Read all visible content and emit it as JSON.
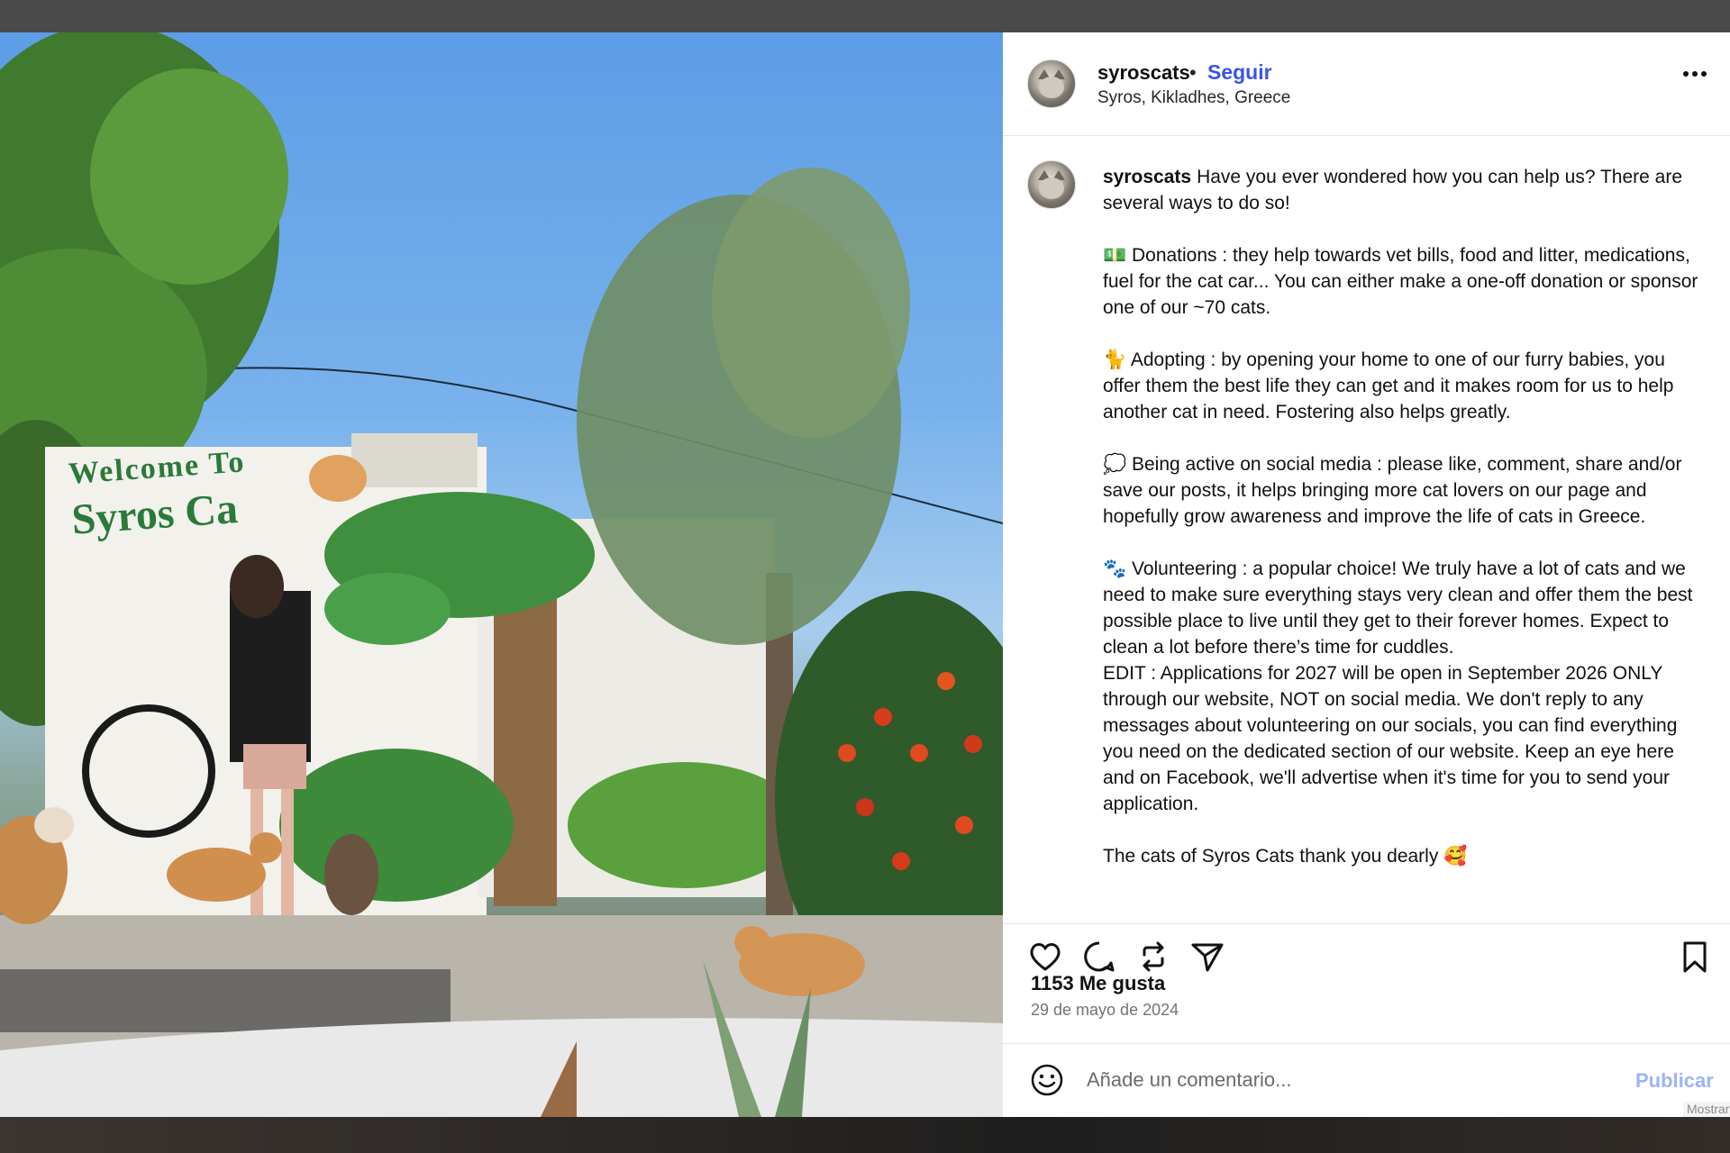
{
  "post": {
    "username": "syroscats",
    "separator": "•",
    "follow_label": "Seguir",
    "location": "Syros, Kikladhes, Greece",
    "more_icon": "more-horizontal-icon"
  },
  "photo": {
    "sign_line1": "Welcome To",
    "sign_line2": "Syros Ca"
  },
  "caption": {
    "username": "syroscats",
    "intro": "Have you ever wondered how you can help us? There are several ways to do so!",
    "donations": "💵 Donations : they help towards vet bills, food and litter, medications, fuel for the cat car... You can either make a one-off donation or sponsor one of our ~70 cats.",
    "adopting": "🐈 Adopting : by opening your home to one of our furry babies, you offer them the best life they can get and it makes room for us to help another cat in need. Fostering also helps greatly.",
    "social": "💭 Being active on social media : please like, comment, share and/or save our posts, it helps bringing more cat lovers on our page and hopefully grow awareness and improve the life of cats in Greece.",
    "volunteering": "🐾 Volunteering : a popular choice! We truly have a lot of cats and we need to make sure everything stays very clean and offer them the best possible place to live until they get to their forever homes. Expect to clean a lot before there’s time for cuddles.",
    "edit": "EDIT : Applications for 2027 will be open in September 2026 ONLY through our website, NOT on social media. We don't reply to any messages about volunteering on our socials, you can find everything you need on the dedicated section of our website. Keep an eye here and on Facebook, we'll advertise when it's time for you to send your application.",
    "thanks": "The cats of Syros Cats thank you dearly 🥰"
  },
  "actions": {
    "like_icon": "heart-icon",
    "comment_icon": "comment-bubble-icon",
    "repost_icon": "repost-icon",
    "share_icon": "send-icon",
    "save_icon": "bookmark-icon"
  },
  "stats": {
    "likes": "1153 Me gusta",
    "date": "29 de mayo de 2024"
  },
  "comment": {
    "placeholder": "Añade un comentario...",
    "publish_label": "Publicar",
    "emoji_icon": "smiley-icon",
    "more_label": "Mostrar"
  }
}
